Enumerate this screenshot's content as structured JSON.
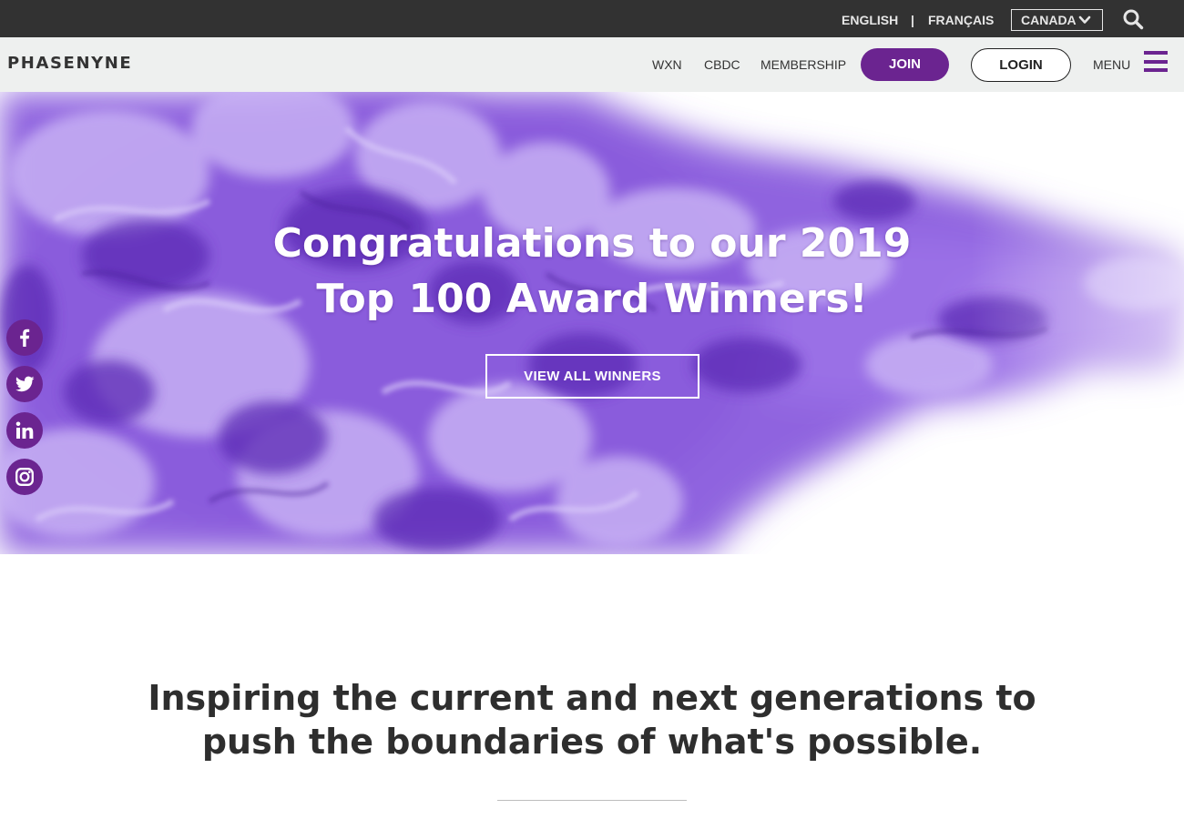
{
  "topbar": {
    "lang_english": "ENGLISH",
    "lang_separator": "|",
    "lang_french": "FRANÇAIS",
    "country": "CANADA",
    "icons": {
      "country_dropdown": "chevron-down-icon",
      "search": "search-icon"
    }
  },
  "navbar": {
    "brand": "PHASENYNE",
    "links": [
      "WXN",
      "CBDC",
      "MEMBERSHIP"
    ],
    "join_label": "JOIN",
    "login_label": "LOGIN",
    "menu_label": "MENU",
    "icons": {
      "menu": "hamburger-icon"
    }
  },
  "hero": {
    "title_line1": "Congratulations to our 2019",
    "title_line2": "Top 100 Award Winners!",
    "cta_label": "VIEW ALL WINNERS"
  },
  "social": [
    {
      "name": "facebook",
      "icon": "facebook-icon"
    },
    {
      "name": "twitter",
      "icon": "twitter-icon"
    },
    {
      "name": "linkedin",
      "icon": "linkedin-icon"
    },
    {
      "name": "instagram",
      "icon": "instagram-icon"
    }
  ],
  "intro": {
    "line1": "Inspiring the current and next generations to",
    "line2": "push the boundaries of what's possible."
  },
  "colors": {
    "brand_purple": "#6b2490",
    "topbar_bg": "#323232",
    "navbar_bg": "#eef0ef",
    "ink_light": "#c9b4f5",
    "ink_mid": "#9a6ee6",
    "ink_dark": "#5f2fb8",
    "heading_text": "#2e2e2e"
  }
}
